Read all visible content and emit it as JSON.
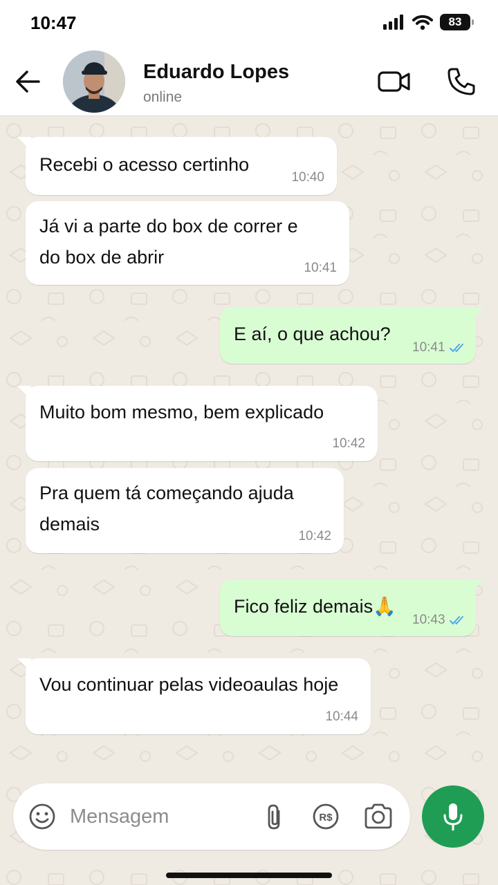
{
  "status_bar": {
    "time": "10:47",
    "battery": "83"
  },
  "header": {
    "contact_name": "Eduardo Lopes",
    "contact_status": "online"
  },
  "messages": [
    {
      "direction": "in",
      "lines": [
        "Recebi o acesso certinho"
      ],
      "time": "10:40"
    },
    {
      "direction": "in",
      "lines": [
        "Já vi a parte do box de correr e",
        "do box de abrir"
      ],
      "time": "10:41"
    },
    {
      "direction": "out",
      "lines": [
        "E aí, o que achou?"
      ],
      "time": "10:41",
      "read": true
    },
    {
      "direction": "in",
      "lines": [
        "Muito bom mesmo, bem explicado"
      ],
      "time": "10:42"
    },
    {
      "direction": "in",
      "lines": [
        "Pra quem tá começando ajuda",
        "demais"
      ],
      "time": "10:42"
    },
    {
      "direction": "out",
      "lines": [
        "Fico feliz demais🙏"
      ],
      "time": "10:43",
      "read": true
    },
    {
      "direction": "in",
      "lines": [
        "Vou continuar pelas videoaulas hoje"
      ],
      "time": "10:44"
    }
  ],
  "composer": {
    "placeholder": "Mensagem"
  },
  "colors": {
    "incoming": "#ffffff",
    "outgoing": "#d9fdd3",
    "accent": "#1f9d55",
    "read_ticks": "#53a6e8",
    "wallpaper": "#efeae2"
  }
}
